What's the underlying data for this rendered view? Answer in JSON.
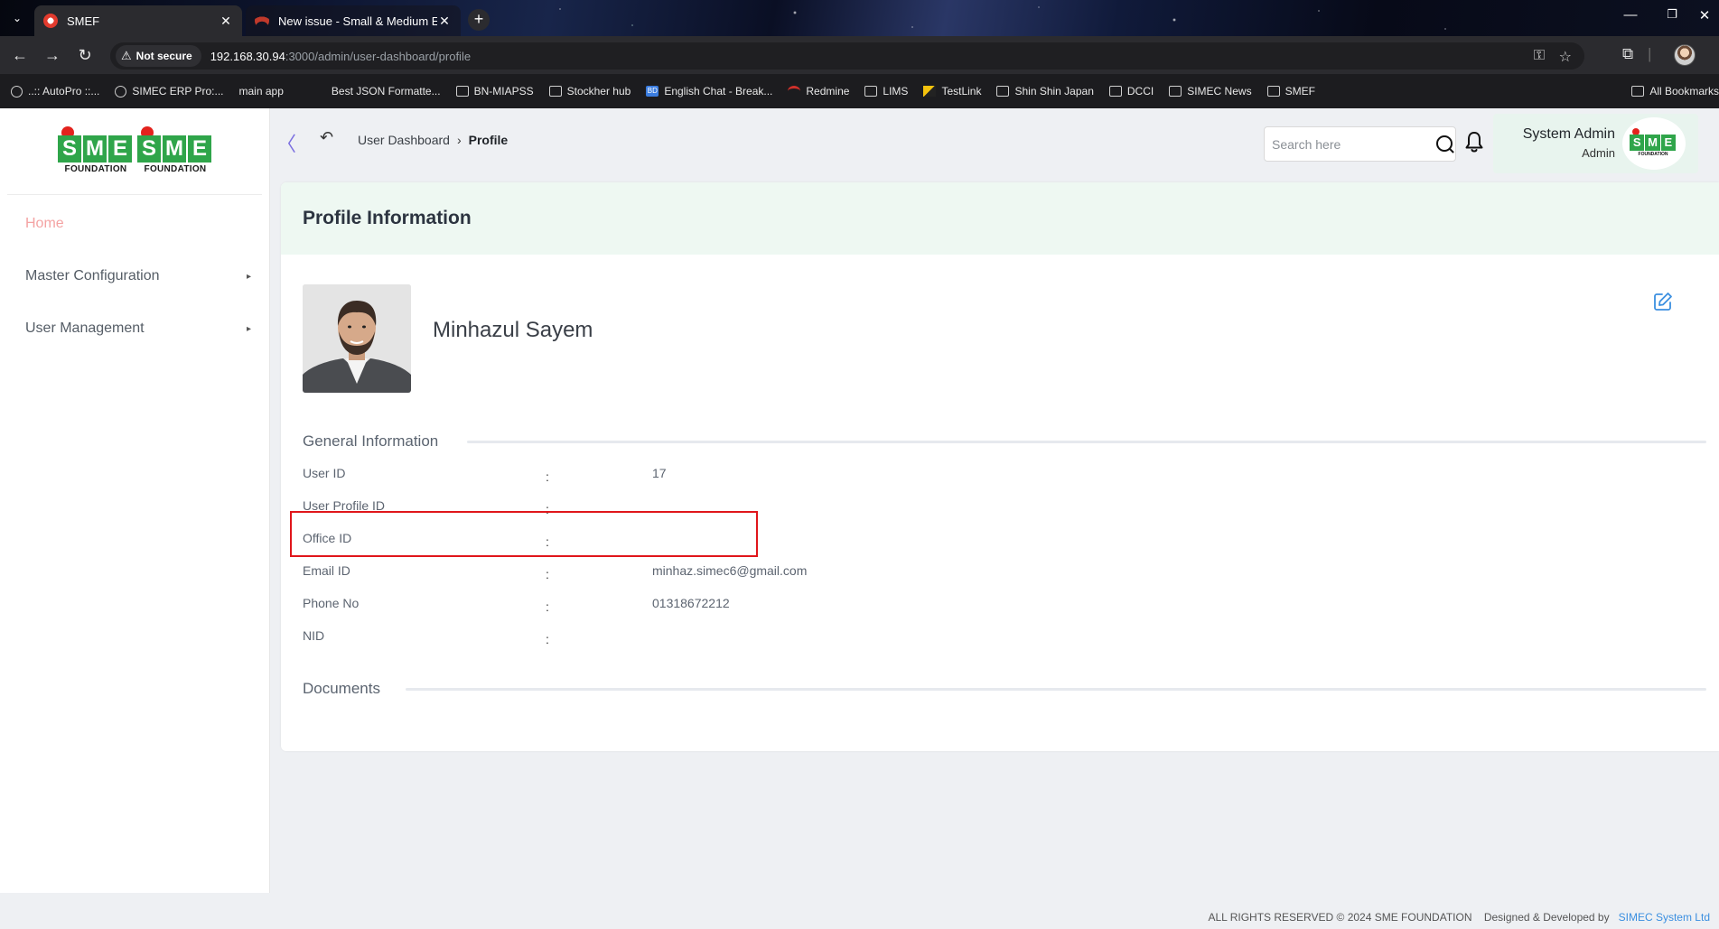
{
  "browser": {
    "tabs": [
      {
        "title": "SMEF",
        "active": true
      },
      {
        "title": "New issue - Small & Medium E",
        "active": false
      }
    ],
    "address": {
      "security_label": "Not secure",
      "host": "192.168.30.94",
      "path": ":3000/admin/user-dashboard/profile"
    },
    "bookmarks": [
      {
        "label": "..:: AutoPro ::...",
        "icon": "globe-icon"
      },
      {
        "label": "SIMEC ERP Pro:...",
        "icon": "globe-icon"
      },
      {
        "label": "main app",
        "icon": "none"
      },
      {
        "label": "Best JSON Formatte...",
        "icon": "none"
      },
      {
        "label": "BN-MIAPSS",
        "icon": "folder-icon"
      },
      {
        "label": "Stockher hub",
        "icon": "folder-icon"
      },
      {
        "label": "English Chat - Break...",
        "icon": "bd-icon"
      },
      {
        "label": "Redmine",
        "icon": "redmine-icon"
      },
      {
        "label": "LIMS",
        "icon": "folder-icon"
      },
      {
        "label": "TestLink",
        "icon": "testlink-icon"
      },
      {
        "label": "Shin Shin Japan",
        "icon": "folder-icon"
      },
      {
        "label": "DCCI",
        "icon": "folder-icon"
      },
      {
        "label": "SIMEC News",
        "icon": "folder-icon"
      },
      {
        "label": "SMEF",
        "icon": "folder-icon"
      }
    ],
    "all_bookmarks": "All Bookmarks"
  },
  "logo": {
    "letters": [
      "S",
      "M",
      "E"
    ],
    "subtitle": "FOUNDATION"
  },
  "sidebar": {
    "items": [
      {
        "label": "Home",
        "active": true,
        "has_children": false
      },
      {
        "label": "Master Configuration",
        "active": false,
        "has_children": true
      },
      {
        "label": "User Management",
        "active": false,
        "has_children": true
      }
    ]
  },
  "header": {
    "breadcrumb": {
      "parent": "User Dashboard",
      "current": "Profile"
    },
    "search_placeholder": "Search here",
    "user": {
      "name": "System Admin",
      "role": "Admin"
    }
  },
  "profile": {
    "card_title": "Profile Information",
    "name": "Minhazul Sayem",
    "general_title": "General Information",
    "fields": [
      {
        "label": "User ID",
        "value": "17"
      },
      {
        "label": "User Profile ID",
        "value": ""
      },
      {
        "label": "Office ID",
        "value": ""
      },
      {
        "label": "Email ID",
        "value": "minhaz.simec6@gmail.com"
      },
      {
        "label": "Phone No",
        "value": "01318672212"
      },
      {
        "label": "NID",
        "value": ""
      }
    ],
    "colon": ":",
    "documents_title": "Documents"
  },
  "footer": {
    "rights": "ALL RIGHTS RESERVED © 2024 SME FOUNDATION",
    "designed": "Designed & Developed by",
    "company": "SIMEC System Ltd"
  },
  "colors": {
    "accent_green": "#2fa54a",
    "logo_red": "#e3221d",
    "highlight_red": "#e0161b",
    "link_blue": "#3b8fe0"
  }
}
